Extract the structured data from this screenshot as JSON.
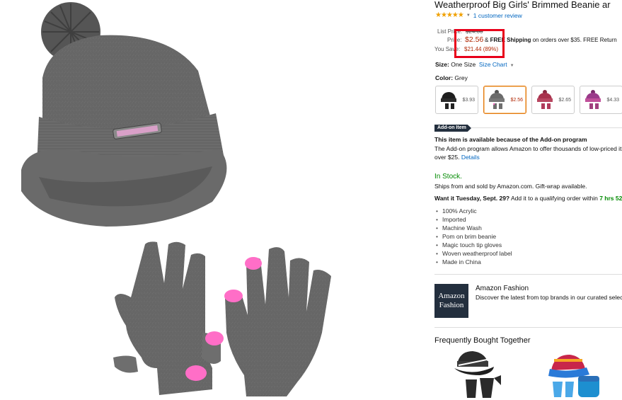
{
  "product": {
    "title": "Weatherproof Big Girls' Brimmed Beanie ar",
    "stars": "★★★★★",
    "reviews_link": "1 customer review"
  },
  "price": {
    "list_label": "List Price:",
    "list_value": "$24.00",
    "price_label": "Price:",
    "price_value": "$2.56",
    "shipping_prefix": " & ",
    "free_shipping": "FREE Shipping",
    "shipping_suffix": " on orders over $35. FREE Return",
    "save_label": "You Save:",
    "save_value": "$21.44 (89%)"
  },
  "size": {
    "label": "Size:",
    "value": "One Size",
    "chart_link": "Size Chart"
  },
  "color": {
    "label": "Color:",
    "value": "Grey"
  },
  "swatches": [
    {
      "price": "$3.93",
      "hat_color": "#1e1e1e",
      "glove_color": "#222222"
    },
    {
      "price": "$2.56",
      "hat_color": "#6b6b6b",
      "glove_color": "#6f6f6f"
    },
    {
      "price": "$2.65",
      "hat_color": "#a8324c",
      "glove_color": "#b03a5a"
    },
    {
      "price": "$4.33",
      "hat_color": "#9a3a8a",
      "glove_color": "#a0407f"
    }
  ],
  "addon": {
    "badge": "Add-on Item",
    "headline": "This item is available because of the Add-on program",
    "text_line1": "The Add-on program allows Amazon to offer thousands of low-priced it",
    "text_line2_prefix": "over $25. ",
    "details_link": "Details"
  },
  "stock": {
    "status": "In Stock.",
    "ships": "Ships from and sold by Amazon.com. Gift-wrap available.",
    "want_bold": "Want it Tuesday, Sept. 29?",
    "want_rest": " Add it to a qualifying order within ",
    "want_time": "7 hrs 52"
  },
  "features": [
    "100% Acrylic",
    "Imported",
    "Machine Wash",
    "Pom on brim beanie",
    "Magic touch tip gloves",
    "Woven weatherproof label",
    "Made in China"
  ],
  "amazon_fashion": {
    "logo_line1": "Amazon",
    "logo_line2": "Fashion",
    "title": "Amazon Fashion",
    "subtitle": "Discover the latest from top brands in our curated selec"
  },
  "frequently_bought": {
    "heading": "Frequently Bought Together"
  },
  "colors": {
    "price_red": "#b12704",
    "link_blue": "#0066c0",
    "stock_green": "#008a00",
    "star_orange": "#f0a000",
    "highlight_red": "#e8001a",
    "product_grey": "#6b6b6b",
    "tip_pink": "#ff6ec7"
  }
}
